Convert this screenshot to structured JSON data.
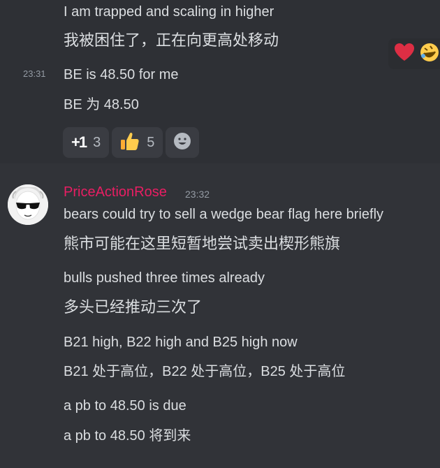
{
  "top_message": {
    "lines": [
      "I am trapped and scaling in higher",
      "我被困住了，正在向更高处移动"
    ]
  },
  "hovered_message": {
    "timestamp": "23:31",
    "lines": [
      "BE is 48.50 for me",
      "BE 为 48.50"
    ],
    "reactions": [
      {
        "emoji": "plus-one-icon",
        "label": "+1",
        "count": "3"
      },
      {
        "emoji": "thumbs-up-icon",
        "count": "5"
      }
    ]
  },
  "message": {
    "username": "PriceActionRose",
    "username_color": "#e91e63",
    "timestamp": "23:32",
    "lines": [
      "bears could try to sell a wedge bear flag here briefly",
      "熊市可能在这里短暂地尝试卖出楔形熊旗",
      "bulls pushed three times already",
      "多头已经推动三次了",
      "B21 high, B22 high and B25 high now",
      "B21 处于高位，B22 处于高位，B25 处于高位",
      "a pb to 48.50 is due",
      "a pb to 48.50 将到来"
    ]
  }
}
